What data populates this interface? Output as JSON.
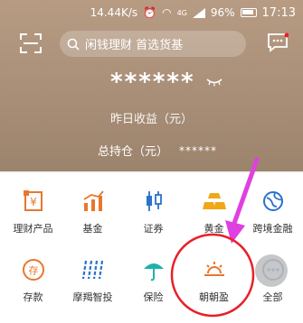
{
  "status": {
    "speed": "14.44K/s",
    "net": "4G",
    "battery": "96%",
    "time": "17:13"
  },
  "search": {
    "placeholder": "闲钱理财 首选货基"
  },
  "account": {
    "masked_amount": "******",
    "yesterday_label": "昨日收益（元）",
    "holding_label": "总持仓（元）",
    "holding_value": "******"
  },
  "menu": {
    "row1": [
      {
        "label": "理财产品",
        "icon": "wealth-product-icon"
      },
      {
        "label": "基金",
        "icon": "fund-chart-icon"
      },
      {
        "label": "证券",
        "icon": "candlestick-icon"
      },
      {
        "label": "黄金",
        "icon": "gold-bars-icon"
      },
      {
        "label": "跨境金融",
        "icon": "globe-icon"
      }
    ],
    "row2": [
      {
        "label": "存款",
        "icon": "deposit-icon"
      },
      {
        "label": "摩羯智投",
        "icon": "smart-invest-icon"
      },
      {
        "label": "保险",
        "icon": "umbrella-icon"
      },
      {
        "label": "朝朝盈",
        "icon": "sunrise-icon"
      },
      {
        "label": "全部",
        "icon": "more-dots-icon"
      }
    ]
  },
  "colors": {
    "accent_orange": "#e8772e",
    "annotation_red": "#e8202a",
    "annotation_magenta": "#e040e0",
    "header_brown": "#a98f78"
  }
}
